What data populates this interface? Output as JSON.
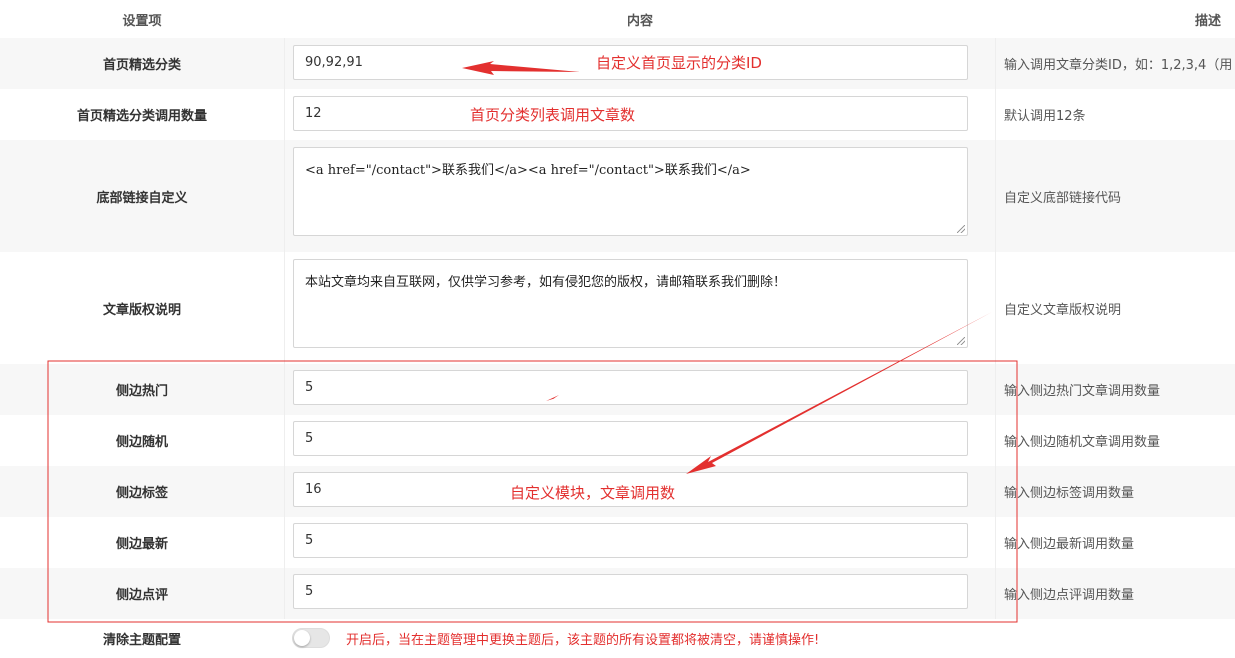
{
  "header": {
    "name_col": "设置项",
    "content_col": "内容",
    "desc_col": "描述"
  },
  "rows": [
    {
      "label": "首页精选分类",
      "value": "90,92,91",
      "desc": "输入调用文章分类ID，如：1,2,3,4（用"
    },
    {
      "label": "首页精选分类调用数量",
      "value": "12",
      "desc": "默认调用12条"
    },
    {
      "label": "底部链接自定义",
      "value": "<a href=\"/contact\">联系我们</a><a href=\"/contact\">联系我们</a>",
      "desc": "自定义底部链接代码"
    },
    {
      "label": "文章版权说明",
      "value": "本站文章均来自互联网，仅供学习参考，如有侵犯您的版权，请邮箱联系我们删除！",
      "desc": "自定义文章版权说明"
    },
    {
      "label": "侧边热门",
      "value": "5",
      "desc": "输入侧边热门文章调用数量"
    },
    {
      "label": "侧边随机",
      "value": "5",
      "desc": "输入侧边随机文章调用数量"
    },
    {
      "label": "侧边标签",
      "value": "16",
      "desc": "输入侧边标签调用数量"
    },
    {
      "label": "侧边最新",
      "value": "5",
      "desc": "输入侧边最新调用数量"
    },
    {
      "label": "侧边点评",
      "value": "5",
      "desc": "输入侧边点评调用数量"
    },
    {
      "label": "清除主题配置",
      "toggle_on": false,
      "warning": "开启后，当在主题管理中更换主题后，该主题的所有设置都将被清空，请谨慎操作!"
    }
  ],
  "annotations": {
    "category_id": "自定义首页显示的分类ID",
    "article_count": "首页分类列表调用文章数",
    "custom_module": "自定义模块，文章调用数"
  },
  "colors": {
    "annotation": "#e3302f",
    "shaded_row": "#f7f7f7"
  }
}
